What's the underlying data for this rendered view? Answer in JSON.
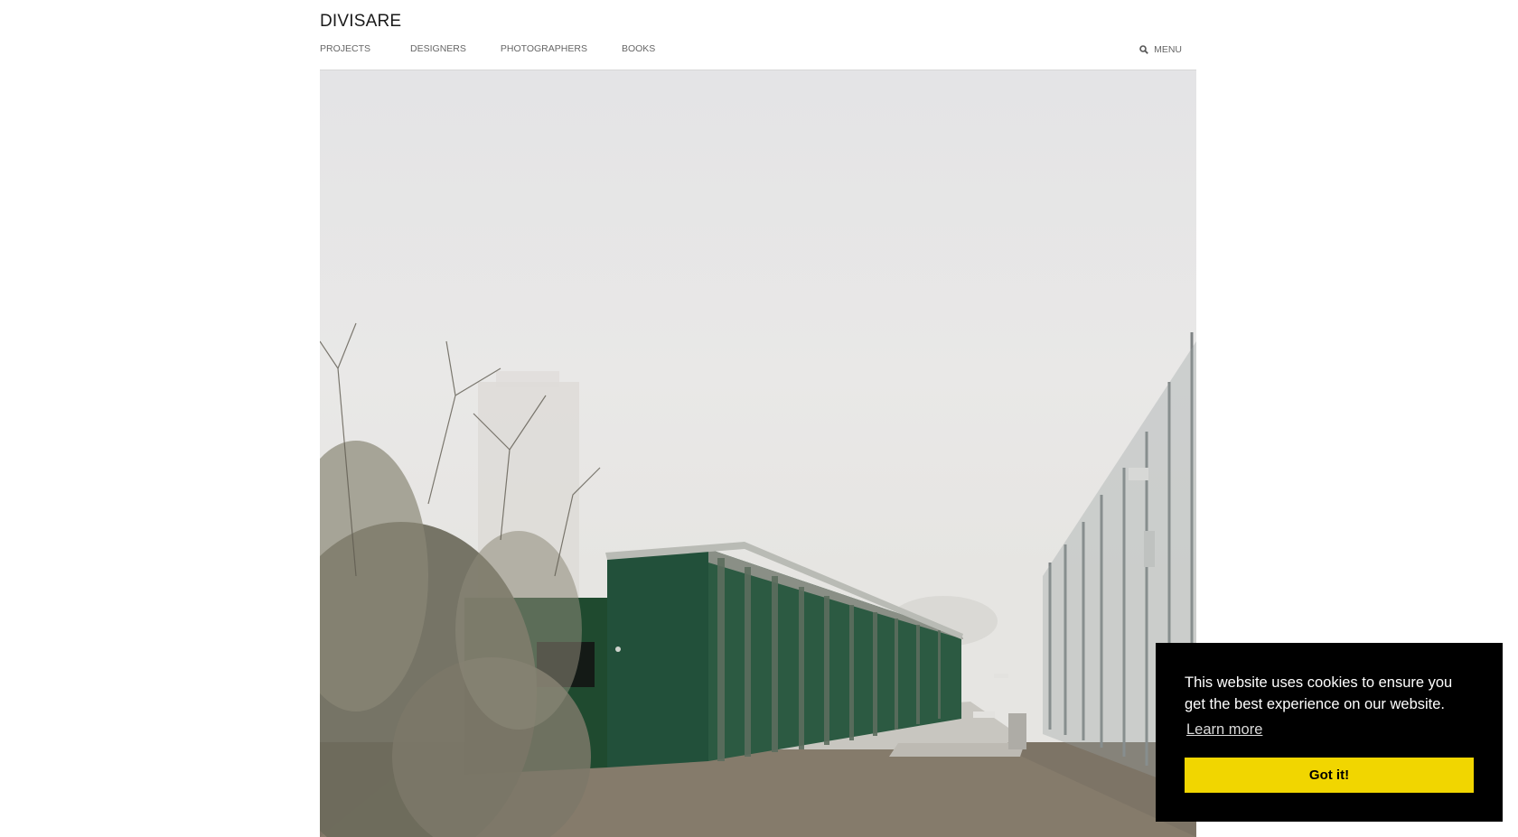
{
  "header": {
    "logo": "DIVISARE",
    "nav": [
      {
        "label": "PROJECTS"
      },
      {
        "label": "DESIGNERS"
      },
      {
        "label": "PHOTOGRAPHERS"
      },
      {
        "label": "BOOKS"
      }
    ],
    "menu_label": "MENU",
    "search_icon": "search-icon"
  },
  "cookie_banner": {
    "message": "This website uses cookies to ensure you get the best experience on our website.",
    "learn_more": "Learn more",
    "button": "Got it!",
    "background": "#000000",
    "button_color": "#f1d600"
  }
}
